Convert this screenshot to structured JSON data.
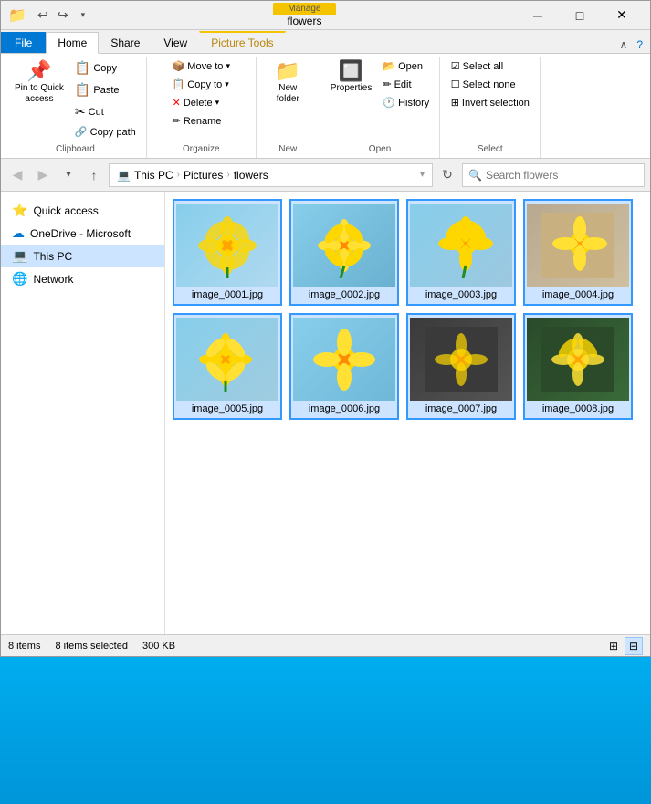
{
  "window": {
    "title": "flowers",
    "manage_label": "Manage",
    "picture_tools_label": "Picture Tools"
  },
  "title_bar": {
    "app_icon": "📁",
    "minimize": "─",
    "maximize": "□",
    "close": "✕",
    "qat": [
      "↩",
      "↪",
      "▾"
    ]
  },
  "tabs": [
    {
      "id": "file",
      "label": "File",
      "active": false
    },
    {
      "id": "home",
      "label": "Home",
      "active": true
    },
    {
      "id": "share",
      "label": "Share",
      "active": false
    },
    {
      "id": "view",
      "label": "View",
      "active": false
    },
    {
      "id": "picture-tools",
      "label": "Picture Tools",
      "active": false
    }
  ],
  "ribbon": {
    "clipboard": {
      "label": "Clipboard",
      "pin_label": "Pin to Quick\naccess",
      "copy_label": "Copy",
      "paste_label": "Paste",
      "cut_icon": "✂",
      "copy_icon": "📋",
      "paste_icon": "📋",
      "move_icon": "📌"
    },
    "organize": {
      "label": "Organize",
      "move_to": "Move to",
      "copy_to": "Copy to",
      "delete": "Delete",
      "rename": "Rename"
    },
    "new": {
      "label": "New",
      "new_folder": "New\nfolder"
    },
    "open": {
      "label": "Open",
      "properties": "Properties"
    },
    "select": {
      "label": "Select",
      "select_all": "Select all",
      "select_none": "Select none",
      "invert": "Invert selection"
    }
  },
  "address_bar": {
    "search_placeholder": "Search flowers",
    "path": [
      "This PC",
      "Pictures",
      "flowers"
    ],
    "refresh_icon": "↻"
  },
  "sidebar": {
    "items": [
      {
        "id": "quick-access",
        "label": "Quick access",
        "icon": "⭐",
        "color": "#f5a623"
      },
      {
        "id": "onedrive",
        "label": "OneDrive - Microsoft",
        "icon": "☁",
        "color": "#0078d4"
      },
      {
        "id": "this-pc",
        "label": "This PC",
        "icon": "💻",
        "selected": true
      },
      {
        "id": "network",
        "label": "Network",
        "icon": "🌐"
      }
    ]
  },
  "files": [
    {
      "id": 1,
      "name": "image_0001.jpg",
      "bg": "sky"
    },
    {
      "id": 2,
      "name": "image_0002.jpg",
      "bg": "sky2"
    },
    {
      "id": 3,
      "name": "image_0003.jpg",
      "bg": "sky3"
    },
    {
      "id": 4,
      "name": "image_0004.jpg",
      "bg": "tan"
    },
    {
      "id": 5,
      "name": "image_0005.jpg",
      "bg": "sky"
    },
    {
      "id": 6,
      "name": "image_0006.jpg",
      "bg": "sky2"
    },
    {
      "id": 7,
      "name": "image_0007.jpg",
      "bg": "dark"
    },
    {
      "id": 8,
      "name": "image_0008.jpg",
      "bg": "darkgreen"
    }
  ],
  "status": {
    "item_count": "8 items",
    "selected": "8 items selected",
    "size": "300 KB"
  },
  "colors": {
    "accent": "#0078d4",
    "selected_border": "#3399ff",
    "selected_bg": "#cce4ff",
    "ribbon_bg": "#ffffff",
    "tab_active_bg": "#ffffff",
    "manage_tab_bg": "#f5c400"
  }
}
